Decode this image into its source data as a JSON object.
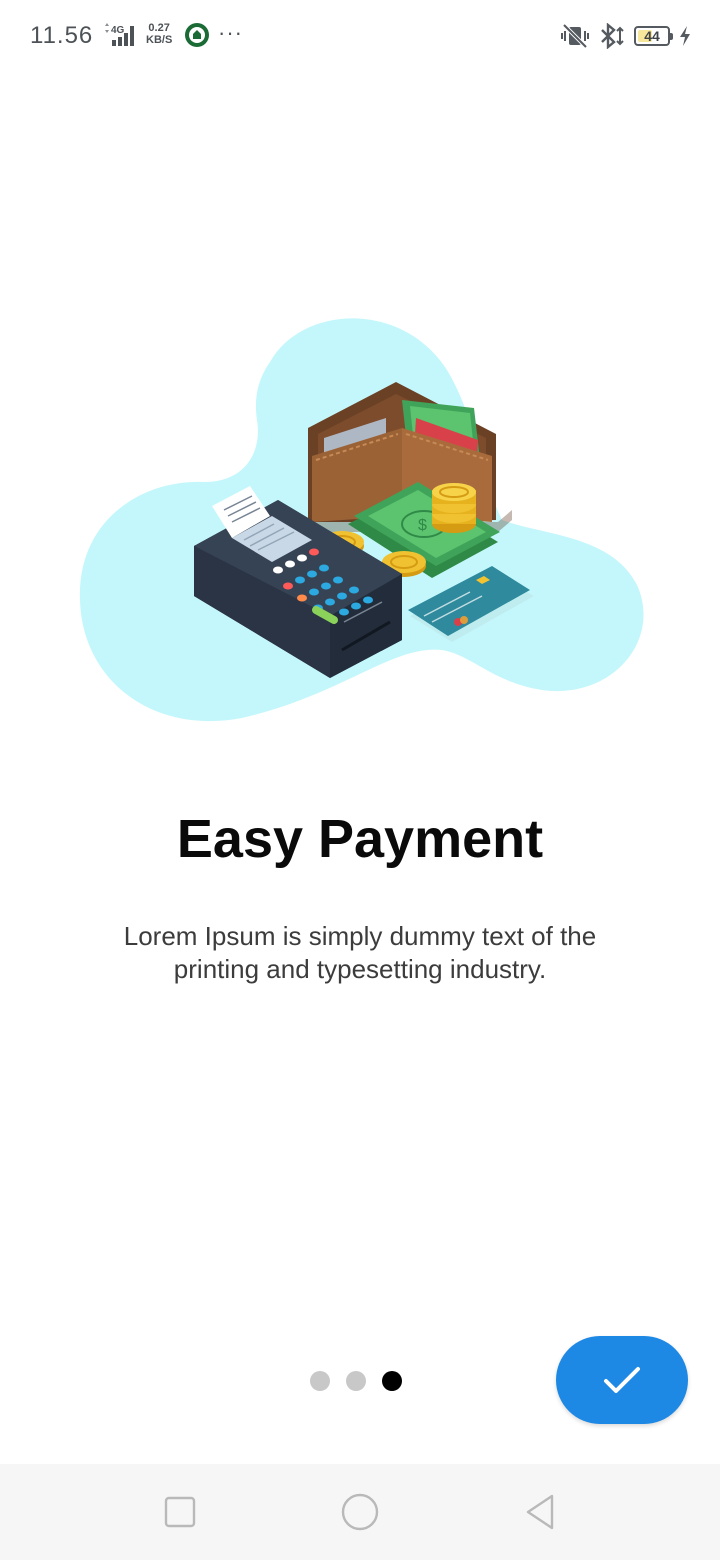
{
  "status_bar": {
    "time": "11.56",
    "network_type": "4G",
    "speed_value": "0.27",
    "speed_unit": "KB/S",
    "more": "···",
    "battery_level": "44",
    "icons": [
      "signal-icon",
      "app-notification-icon",
      "vibrate-off-icon",
      "bluetooth-icon",
      "battery-icon",
      "charging-icon"
    ]
  },
  "onboarding": {
    "title": "Easy Payment",
    "description": "Lorem Ipsum is simply dummy text of the printing and typesetting industry.",
    "page_count": 3,
    "active_page": 3
  },
  "done_button": {
    "icon": "check-icon"
  },
  "colors": {
    "accent": "#1e88e5",
    "blob": "#c4f7fb",
    "dot_inactive": "#c8c8c8",
    "dot_active": "#000000"
  },
  "nav_bar": {
    "icons": [
      "recents-square-icon",
      "home-circle-icon",
      "back-triangle-icon"
    ]
  }
}
